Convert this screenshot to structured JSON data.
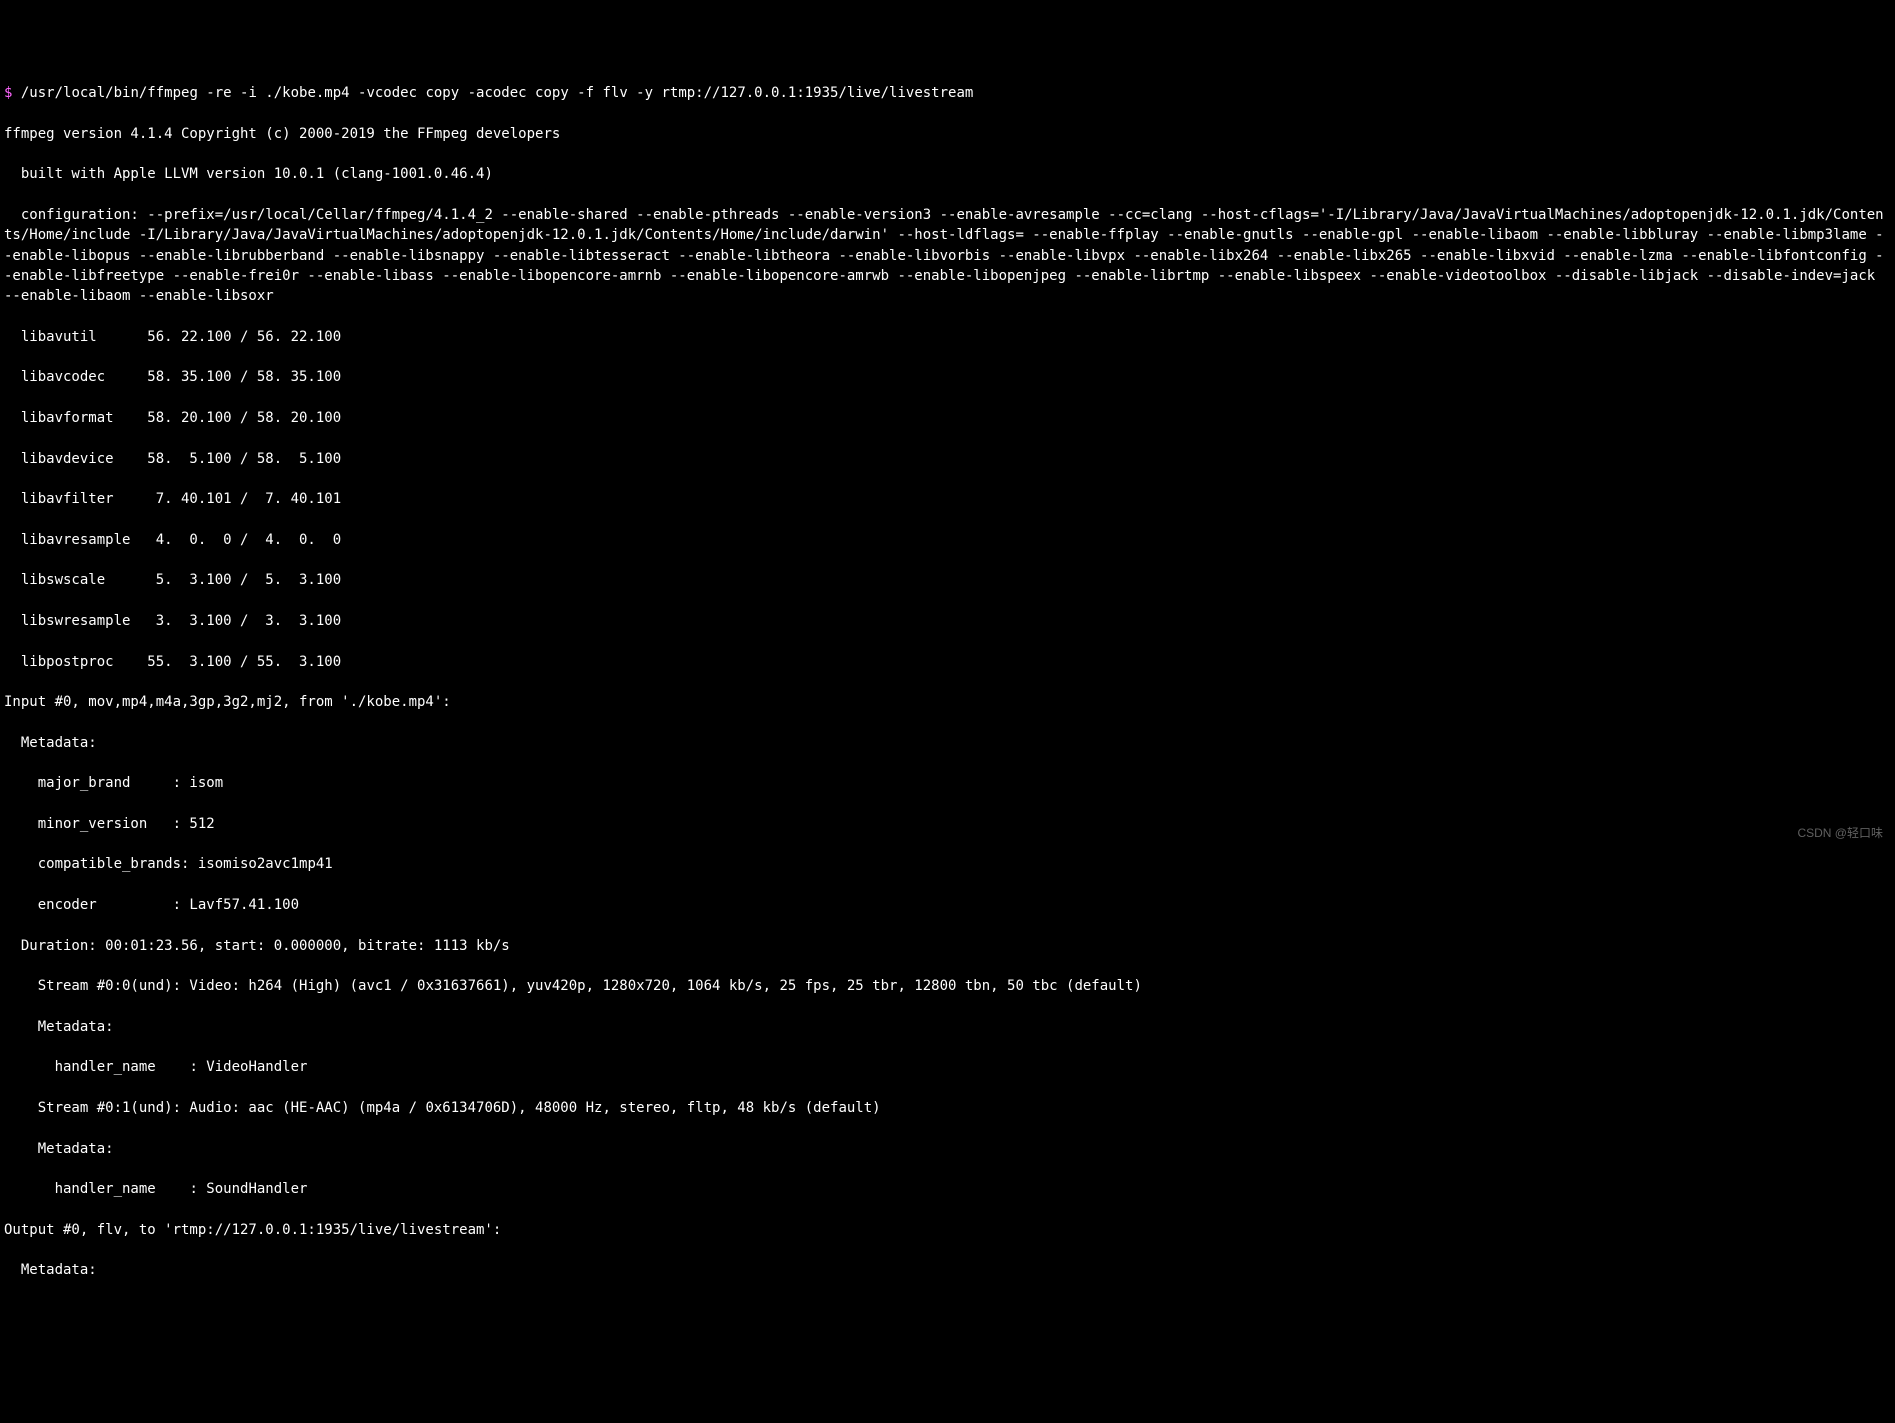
{
  "prompt": "$",
  "command": "/usr/local/bin/ffmpeg -re -i ./kobe.mp4 -vcodec copy -acodec copy -f flv -y rtmp://127.0.0.1:1935/live/livestream",
  "version_line": "ffmpeg version 4.1.4 Copyright (c) 2000-2019 the FFmpeg developers",
  "built_with": "  built with Apple LLVM version 10.0.1 (clang-1001.0.46.4)",
  "configuration": "  configuration: --prefix=/usr/local/Cellar/ffmpeg/4.1.4_2 --enable-shared --enable-pthreads --enable-version3 --enable-avresample --cc=clang --host-cflags='-I/Library/Java/JavaVirtualMachines/adoptopenjdk-12.0.1.jdk/Contents/Home/include -I/Library/Java/JavaVirtualMachines/adoptopenjdk-12.0.1.jdk/Contents/Home/include/darwin' --host-ldflags= --enable-ffplay --enable-gnutls --enable-gpl --enable-libaom --enable-libbluray --enable-libmp3lame --enable-libopus --enable-librubberband --enable-libsnappy --enable-libtesseract --enable-libtheora --enable-libvorbis --enable-libvpx --enable-libx264 --enable-libx265 --enable-libxvid --enable-lzma --enable-libfontconfig --enable-libfreetype --enable-frei0r --enable-libass --enable-libopencore-amrnb --enable-libopencore-amrwb --enable-libopenjpeg --enable-librtmp --enable-libspeex --enable-videotoolbox --disable-libjack --disable-indev=jack --enable-libaom --enable-libsoxr",
  "libs": [
    "  libavutil      56. 22.100 / 56. 22.100",
    "  libavcodec     58. 35.100 / 58. 35.100",
    "  libavformat    58. 20.100 / 58. 20.100",
    "  libavdevice    58.  5.100 / 58.  5.100",
    "  libavfilter     7. 40.101 /  7. 40.101",
    "  libavresample   4.  0.  0 /  4.  0.  0",
    "  libswscale      5.  3.100 /  5.  3.100",
    "  libswresample   3.  3.100 /  3.  3.100",
    "  libpostproc    55.  3.100 / 55.  3.100"
  ],
  "input_header": "Input #0, mov,mp4,m4a,3gp,3g2,mj2, from './kobe.mp4':",
  "metadata_label": "  Metadata:",
  "metadata": [
    "    major_brand     : isom",
    "    minor_version   : 512",
    "    compatible_brands: isomiso2avc1mp41",
    "    encoder         : Lavf57.41.100"
  ],
  "duration": "  Duration: 00:01:23.56, start: 0.000000, bitrate: 1113 kb/s",
  "stream0": "    Stream #0:0(und): Video: h264 (High) (avc1 / 0x31637661), yuv420p, 1280x720, 1064 kb/s, 25 fps, 25 tbr, 12800 tbn, 50 tbc (default)",
  "stream0_meta_label": "    Metadata:",
  "stream0_meta": "      handler_name    : VideoHandler",
  "stream1": "    Stream #0:1(und): Audio: aac (HE-AAC) (mp4a / 0x6134706D), 48000 Hz, stereo, fltp, 48 kb/s (default)",
  "stream1_meta_label": "    Metadata:",
  "stream1_meta": "      handler_name    : SoundHandler",
  "output_header": "Output #0, flv, to 'rtmp://127.0.0.1:1935/live/livestream':",
  "output_meta_label": "  Metadata:",
  "watermark": "CSDN @轻口味"
}
